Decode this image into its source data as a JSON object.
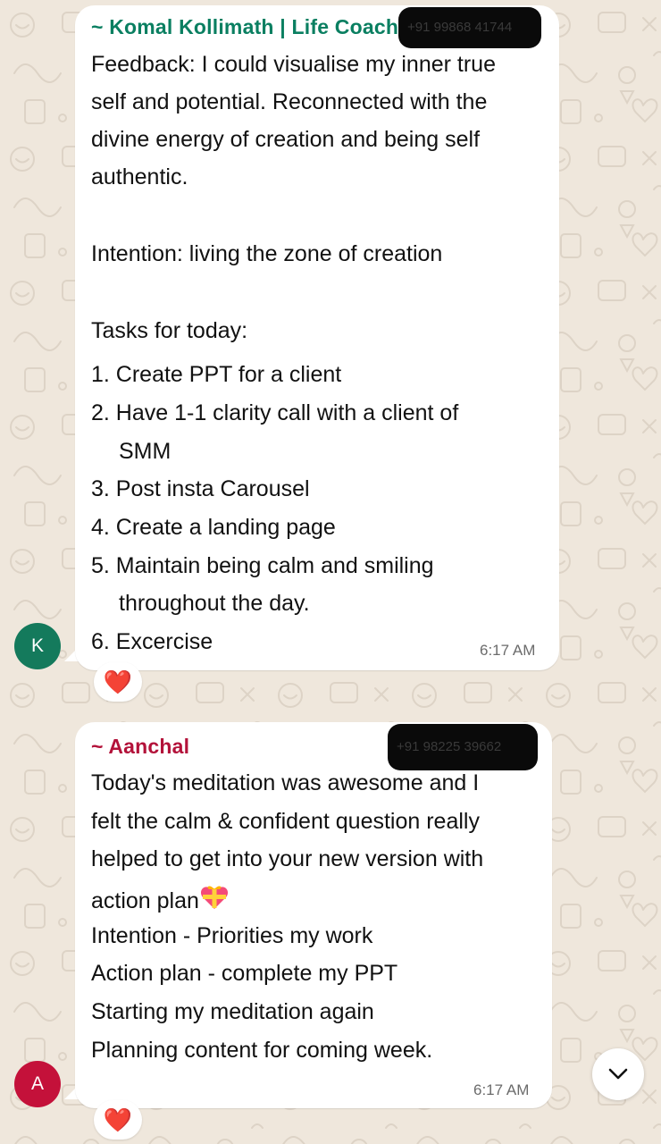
{
  "messages": [
    {
      "sender": "~ Komal Kollimath | Life Coach",
      "sender_color": "#0a7f61",
      "phone": "+91 99868 41744",
      "lines": [
        "Feedback: I could visualise my inner true",
        "self and potential. Reconnected with the",
        "divine energy of creation and being self",
        "authentic.",
        "Intention: living the zone of creation",
        "Tasks for today:",
        "1. Create PPT for a client",
        "2. Have 1-1 clarity call with a client of",
        "SMM",
        "3. Post insta Carousel",
        "4. Create a landing page",
        "5. Maintain being calm and smiling",
        "throughout the day.",
        "6. Excercise"
      ],
      "time": "6:17 AM",
      "avatar_letter": "K",
      "avatar_color": "#147a5c",
      "reaction": "❤️"
    },
    {
      "sender": "~ Aanchal",
      "sender_color": "#b3123a",
      "phone": "+91 98225 39662",
      "lines": [
        "Today's meditation was awesome and I",
        "felt the calm & confident question really",
        "helped to get into your new version with",
        "action plan",
        "Intention - Priorities my work",
        "Action plan - complete my PPT",
        "Starting my meditation again",
        "Planning content for coming week."
      ],
      "emoji_icon": "heart-gift-icon",
      "time": "6:17 AM",
      "avatar_letter": "A",
      "avatar_color": "#c4113a",
      "reaction": "❤️"
    }
  ],
  "scroll_button_icon": "chevron-down-icon"
}
